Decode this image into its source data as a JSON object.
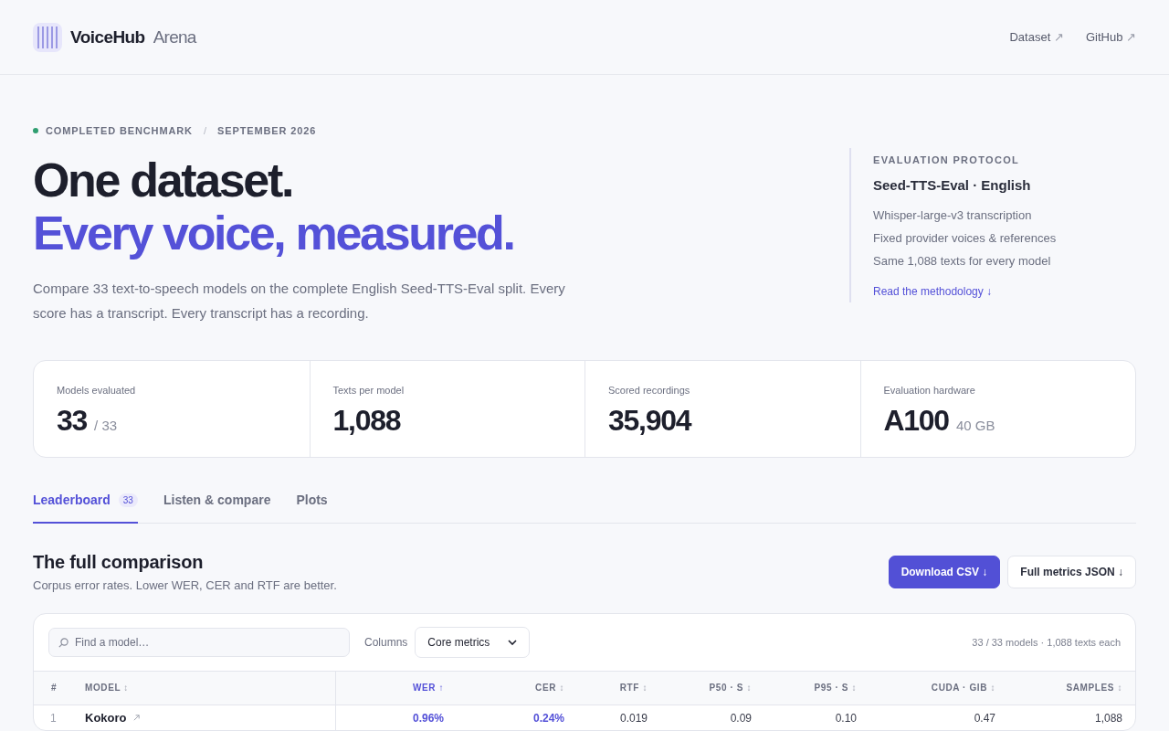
{
  "header": {
    "brand": "VoiceHub",
    "brand_suffix": "Arena",
    "links": [
      {
        "label": "Dataset",
        "arrow": "↗"
      },
      {
        "label": "GitHub",
        "arrow": "↗"
      }
    ]
  },
  "hero": {
    "eyebrow": [
      "COMPLETED BENCHMARK",
      "SEPTEMBER 2026"
    ],
    "eyebrow_separator": "/",
    "title": "One dataset.",
    "title_accent": "Every voice, measured.",
    "intro": "Compare 33 text-to-speech models on the complete English Seed-TTS-Eval split. Every score has a transcript. Every transcript has a recording."
  },
  "protocol": {
    "heading": "EVALUATION PROTOCOL",
    "title": "Seed-TTS-Eval · English",
    "items": [
      "Whisper-large-v3 transcription",
      "Fixed provider voices & references",
      "Same 1,088 texts for every model"
    ],
    "link": "Read the methodology ↓"
  },
  "stats": [
    {
      "label": "Models evaluated",
      "value": "33",
      "suffix": "/ 33"
    },
    {
      "label": "Texts per model",
      "value": "1,088"
    },
    {
      "label": "Scored recordings",
      "value": "35,904"
    },
    {
      "label": "Evaluation hardware",
      "value": "A100",
      "suffix": "40 GB"
    }
  ],
  "tabs": [
    {
      "label": "Leaderboard",
      "badge": "33",
      "selected": true
    },
    {
      "label": "Listen & compare",
      "selected": false
    },
    {
      "label": "Plots",
      "selected": false
    }
  ],
  "section": {
    "title": "The full comparison",
    "subtitle": "Corpus error rates. Lower WER, CER and RTF are better.",
    "buttons": [
      {
        "label": "Download CSV ↓",
        "kind": "primary"
      },
      {
        "label": "Full metrics JSON ↓",
        "kind": "secondary"
      }
    ]
  },
  "table": {
    "search": {
      "placeholder": "Find a model…"
    },
    "columns_label": "Columns",
    "columns_select": "Core metrics",
    "summary": "33 / 33 models · 1,088 texts each",
    "columns": [
      {
        "label": "#",
        "sorted": false
      },
      {
        "label": "MODEL",
        "sort": "↕",
        "sorted": false
      },
      {
        "label": "WER",
        "sort": "↑",
        "sorted": true
      },
      {
        "label": "CER",
        "sort": "↕",
        "sorted": false
      },
      {
        "label": "RTF",
        "sort": "↕",
        "sorted": false
      },
      {
        "label": "P50 · S",
        "sort": "↕",
        "sorted": false
      },
      {
        "label": "P95 · S",
        "sort": "↕",
        "sorted": false
      },
      {
        "label": "CUDA · GIB",
        "sort": "↕",
        "sorted": false
      },
      {
        "label": "SAMPLES",
        "sort": "↕",
        "sorted": false
      }
    ],
    "rows": [
      {
        "rank": "1",
        "model": "Kokoro",
        "values": [
          {
            "text": "0.96%",
            "best": true
          },
          {
            "text": "0.24%",
            "best": true
          },
          {
            "text": "0.019",
            "best": false
          },
          {
            "text": "0.09",
            "best": false
          },
          {
            "text": "0.10",
            "best": false
          },
          {
            "text": "0.47",
            "best": false
          },
          {
            "text": "1,088",
            "best": false
          }
        ]
      }
    ]
  }
}
